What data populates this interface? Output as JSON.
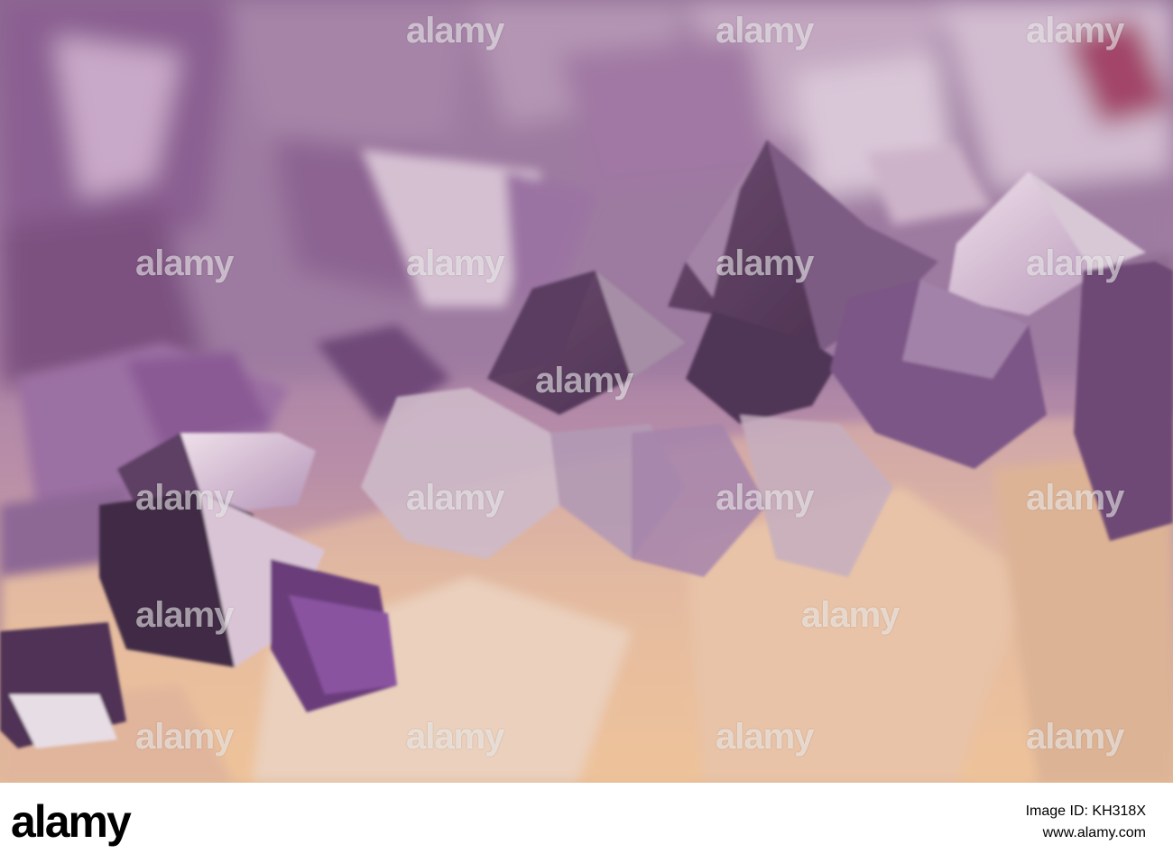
{
  "watermark": {
    "text": "alamy"
  },
  "footer": {
    "logo": "alamy",
    "image_id_label": "Image ID: KH318X",
    "site": "www.alamy.com"
  }
}
